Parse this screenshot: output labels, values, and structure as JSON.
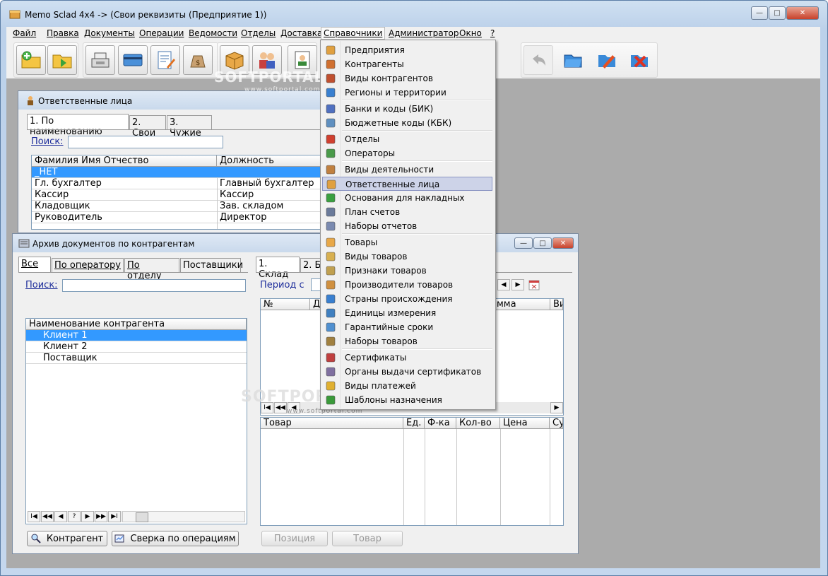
{
  "app": {
    "title": "Memo Sclad 4x4 -> (Свои реквизиты (Предприятие 1))",
    "min_glyph": "—",
    "max_glyph": "□",
    "close_glyph": "✕"
  },
  "menu": {
    "items": [
      "Файл",
      "Правка",
      "Документы",
      "Операции",
      "Ведомости",
      "Отделы",
      "Доставка",
      "Справочники",
      "Администратор",
      "Окно",
      "?"
    ],
    "active": "Справочники"
  },
  "dropdown": {
    "items": [
      {
        "label": "Предприятия",
        "icon": "person-icon"
      },
      {
        "label": "Контрагенты",
        "icon": "people-icon"
      },
      {
        "label": "Виды контрагентов",
        "icon": "people-question-icon"
      },
      {
        "label": "Регионы и территории",
        "icon": "globe-icon"
      },
      {
        "label": "Банки и коды (БИК)",
        "icon": "bank-icon"
      },
      {
        "label": "Бюджетные коды (КБК)",
        "icon": "budget-icon"
      },
      {
        "label": "Отделы",
        "icon": "house-icon"
      },
      {
        "label": "Операторы",
        "icon": "operator-icon"
      },
      {
        "label": "Виды деятельности",
        "icon": "activity-icon"
      },
      {
        "label": "Ответственные лица",
        "icon": "responsible-icon"
      },
      {
        "label": "Основания для накладных",
        "icon": "basis-icon"
      },
      {
        "label": "План счетов",
        "icon": "accounts-icon"
      },
      {
        "label": "Наборы отчетов",
        "icon": "reports-icon"
      },
      {
        "label": "Товары",
        "icon": "box-icon"
      },
      {
        "label": "Виды товаров",
        "icon": "goods-types-icon"
      },
      {
        "label": "Признаки товаров",
        "icon": "goods-attr-icon"
      },
      {
        "label": "Производители товаров",
        "icon": "manufacturer-icon"
      },
      {
        "label": "Страны происхождения",
        "icon": "country-icon"
      },
      {
        "label": "Единицы измерения",
        "icon": "units-icon"
      },
      {
        "label": "Гарантийные сроки",
        "icon": "warranty-icon"
      },
      {
        "label": "Наборы товаров",
        "icon": "goods-set-icon"
      },
      {
        "label": "Сертификаты",
        "icon": "certificate-icon"
      },
      {
        "label": "Органы выдачи сертификатов",
        "icon": "cert-authority-icon"
      },
      {
        "label": "Виды платежей",
        "icon": "payment-icon"
      },
      {
        "label": "Шаблоны назначения",
        "icon": "template-icon"
      }
    ],
    "highlighted": "Ответственные лица"
  },
  "resp_window": {
    "title": "Ответственные лица",
    "tabs": [
      "1. По наименованию",
      "2. Свои",
      "3. Чужие"
    ],
    "search_label": "Поиск:",
    "search_value": "",
    "columns": [
      "Фамилия Имя Отчество",
      "Должность"
    ],
    "rows": [
      [
        "_НЕТ",
        ""
      ],
      [
        "Гл. бухгалтер",
        "Главный бухгалтер"
      ],
      [
        "Кассир",
        "Кассир"
      ],
      [
        "Кладовщик",
        "Зав. складом"
      ],
      [
        "Руководитель",
        "Директор"
      ]
    ]
  },
  "archive_window": {
    "title": "Архив документов по контрагентам",
    "left_tabs": [
      "Все",
      "По оператору",
      "По отделу",
      "Поставщики"
    ],
    "search_label": "Поиск:",
    "search_value": "",
    "list_header": "Наименование контрагента",
    "list_rows": [
      "Клиент 1",
      "Клиент 2",
      "Поставщик"
    ],
    "nav": [
      "I◀",
      "◀◀",
      "◀",
      "?",
      "▶",
      "▶▶",
      "▶I"
    ],
    "btn_contractor": "Контрагент",
    "btn_reconcile": "Сверка по операциям",
    "right_tabs": [
      "1. Склад",
      "2. Б"
    ],
    "period_label": "Период с",
    "doc_columns": [
      "№",
      "Да",
      "мма",
      "Ви"
    ],
    "goods_columns": [
      "Товар",
      "Ед.",
      "Ф-ка",
      "Кол-во",
      "Цена",
      "Су"
    ],
    "btn_position": "Позиция",
    "btn_goods": "Товар"
  },
  "watermark": {
    "text": "SOFTPORTAL",
    "url": "www.softportal.com"
  }
}
